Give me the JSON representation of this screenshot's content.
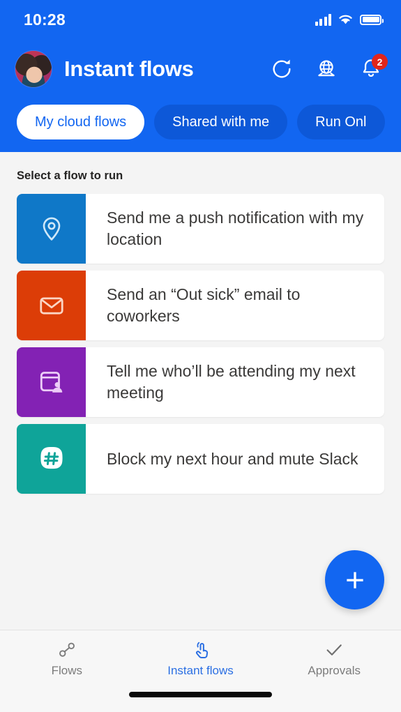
{
  "status_bar": {
    "time": "10:28",
    "signal_icon": "cellular-signal-icon",
    "wifi_icon": "wifi-icon",
    "battery_icon": "battery-full-icon"
  },
  "header": {
    "title": "Instant flows",
    "avatar_name": "user-avatar",
    "background_color": "#1266f1",
    "actions": [
      {
        "name": "refresh-icon",
        "label": "Refresh"
      },
      {
        "name": "globe-icon",
        "label": "Environment"
      },
      {
        "name": "notifications-bell-icon",
        "label": "Notifications",
        "badge": "2"
      }
    ]
  },
  "tabs": [
    {
      "label": "My cloud flows",
      "active": true
    },
    {
      "label": "Shared with me",
      "active": false
    },
    {
      "label": "Run Onl",
      "active": false
    }
  ],
  "content": {
    "section_title": "Select a flow to run",
    "flows": [
      {
        "label": "Send me a push notification with my location",
        "icon": "location-pin-icon",
        "color": "#0f78c8"
      },
      {
        "label": "Send an “Out sick” email to coworkers",
        "icon": "envelope-icon",
        "color": "#dc3d07"
      },
      {
        "label": "Tell me who’ll be attending my next meeting",
        "icon": "meeting-attendees-icon",
        "color": "#8322b4"
      },
      {
        "label": "Block my next hour and mute Slack",
        "icon": "slack-hash-icon",
        "color": "#0fa499"
      }
    ]
  },
  "fab": {
    "name": "create-flow-button",
    "icon": "plus-icon",
    "color": "#1266f1"
  },
  "bottom_nav": {
    "active_color": "#2b6fe3",
    "items": [
      {
        "label": "Flows",
        "icon": "flow-nodes-icon",
        "active": false
      },
      {
        "label": "Instant flows",
        "icon": "tap-hand-icon",
        "active": true
      },
      {
        "label": "Approvals",
        "icon": "checkmark-icon",
        "active": false
      }
    ]
  }
}
